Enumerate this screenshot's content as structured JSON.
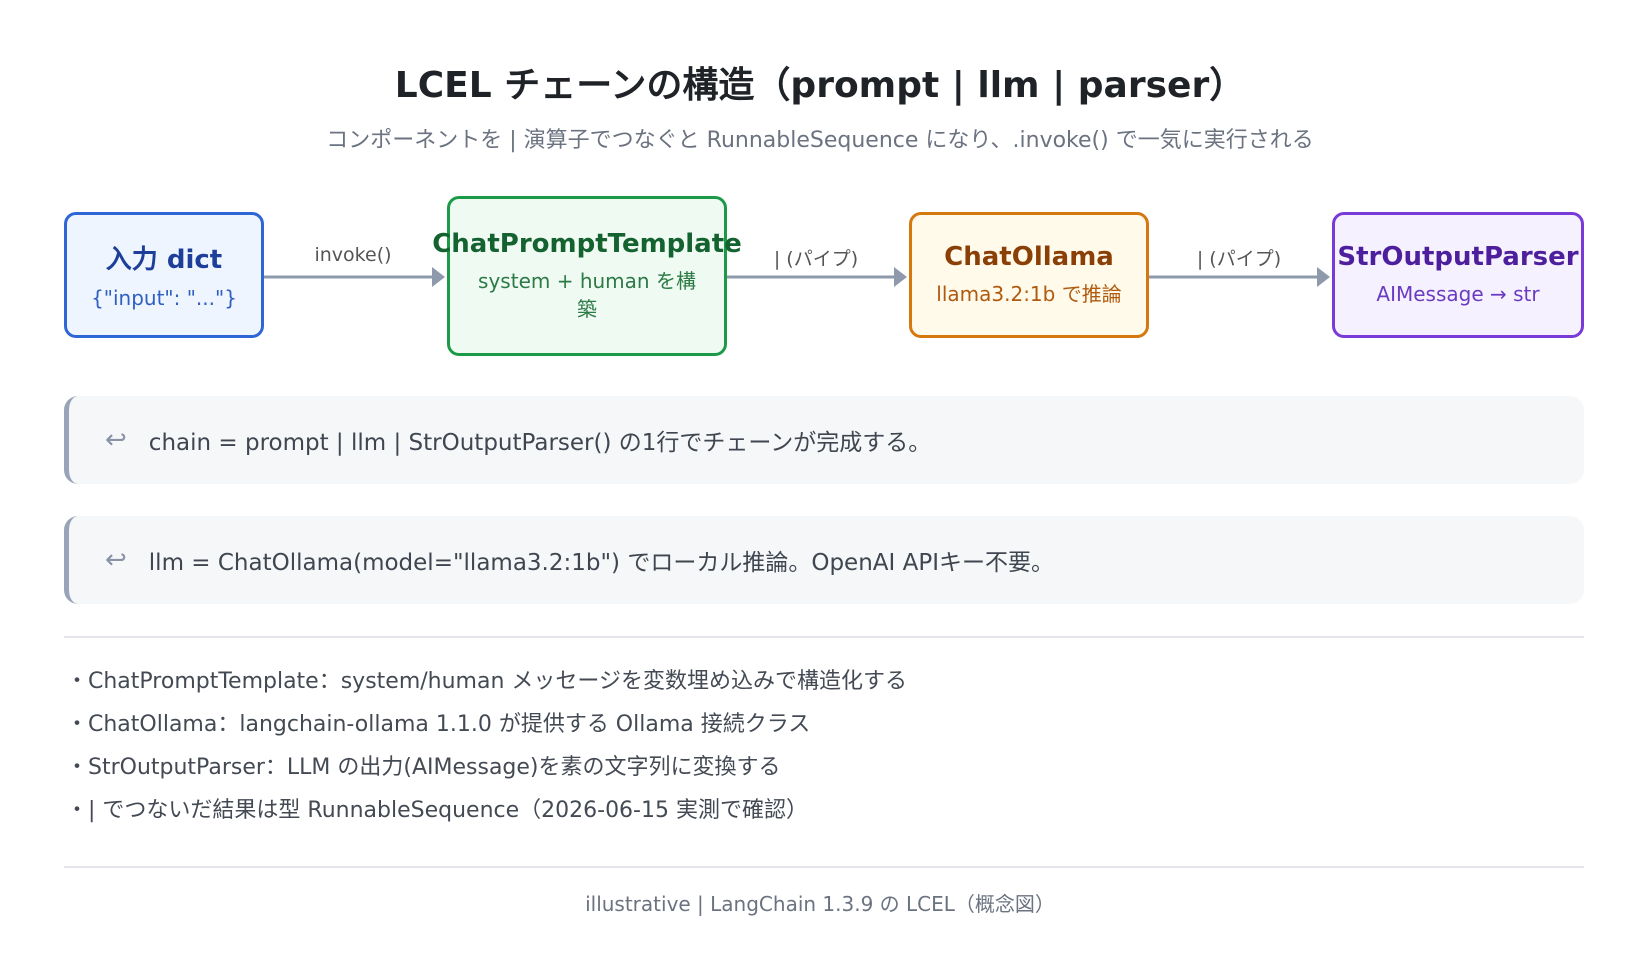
{
  "header": {
    "title": "LCEL チェーンの構造（prompt | llm | parser）",
    "subtitle": "コンポーネントを | 演算子でつなぐと RunnableSequence になり、.invoke() で一気に実行される"
  },
  "diagram": {
    "nodes": [
      {
        "title": "入力 dict",
        "subtitle": "{\"input\": \"...\"}",
        "border_color": "#2f66d6",
        "fill_color": "#eef5ff"
      },
      {
        "title": "ChatPromptTemplate",
        "subtitle": "system + human を構築",
        "border_color": "#1d9a48",
        "fill_color": "#effaf2"
      },
      {
        "title": "ChatOllama",
        "subtitle": "llama3.2:1b で推論",
        "border_color": "#d5780e",
        "fill_color": "#fffaea"
      },
      {
        "title": "StrOutputParser",
        "subtitle": "AIMessage → str",
        "border_color": "#7a3ad8",
        "fill_color": "#f5f1ff"
      }
    ],
    "edges": [
      {
        "label": "invoke()"
      },
      {
        "label": "| (パイプ)"
      },
      {
        "label": "| (パイプ)"
      }
    ],
    "edge_color": "#8e99ab"
  },
  "notes": [
    {
      "icon": "return-arrow-icon",
      "glyph": "↩",
      "text": "chain = prompt | llm | StrOutputParser() の1行でチェーンが完成する。"
    },
    {
      "icon": "return-arrow-icon",
      "glyph": "↩",
      "text": "llm = ChatOllama(model=\"llama3.2:1b\") でローカル推論。OpenAI APIキー不要。"
    }
  ],
  "bullets": [
    "・ChatPromptTemplate：system/human メッセージを変数埋め込みで構造化する",
    "・ChatOllama：langchain-ollama 1.1.0 が提供する Ollama 接続クラス",
    "・StrOutputParser：LLM の出力(AIMessage)を素の文字列に変換する",
    "・| でつないだ結果は型 RunnableSequence（2026-06-15 実測で確認）"
  ],
  "footer": "illustrative | LangChain 1.3.9 の LCEL（概念図）"
}
